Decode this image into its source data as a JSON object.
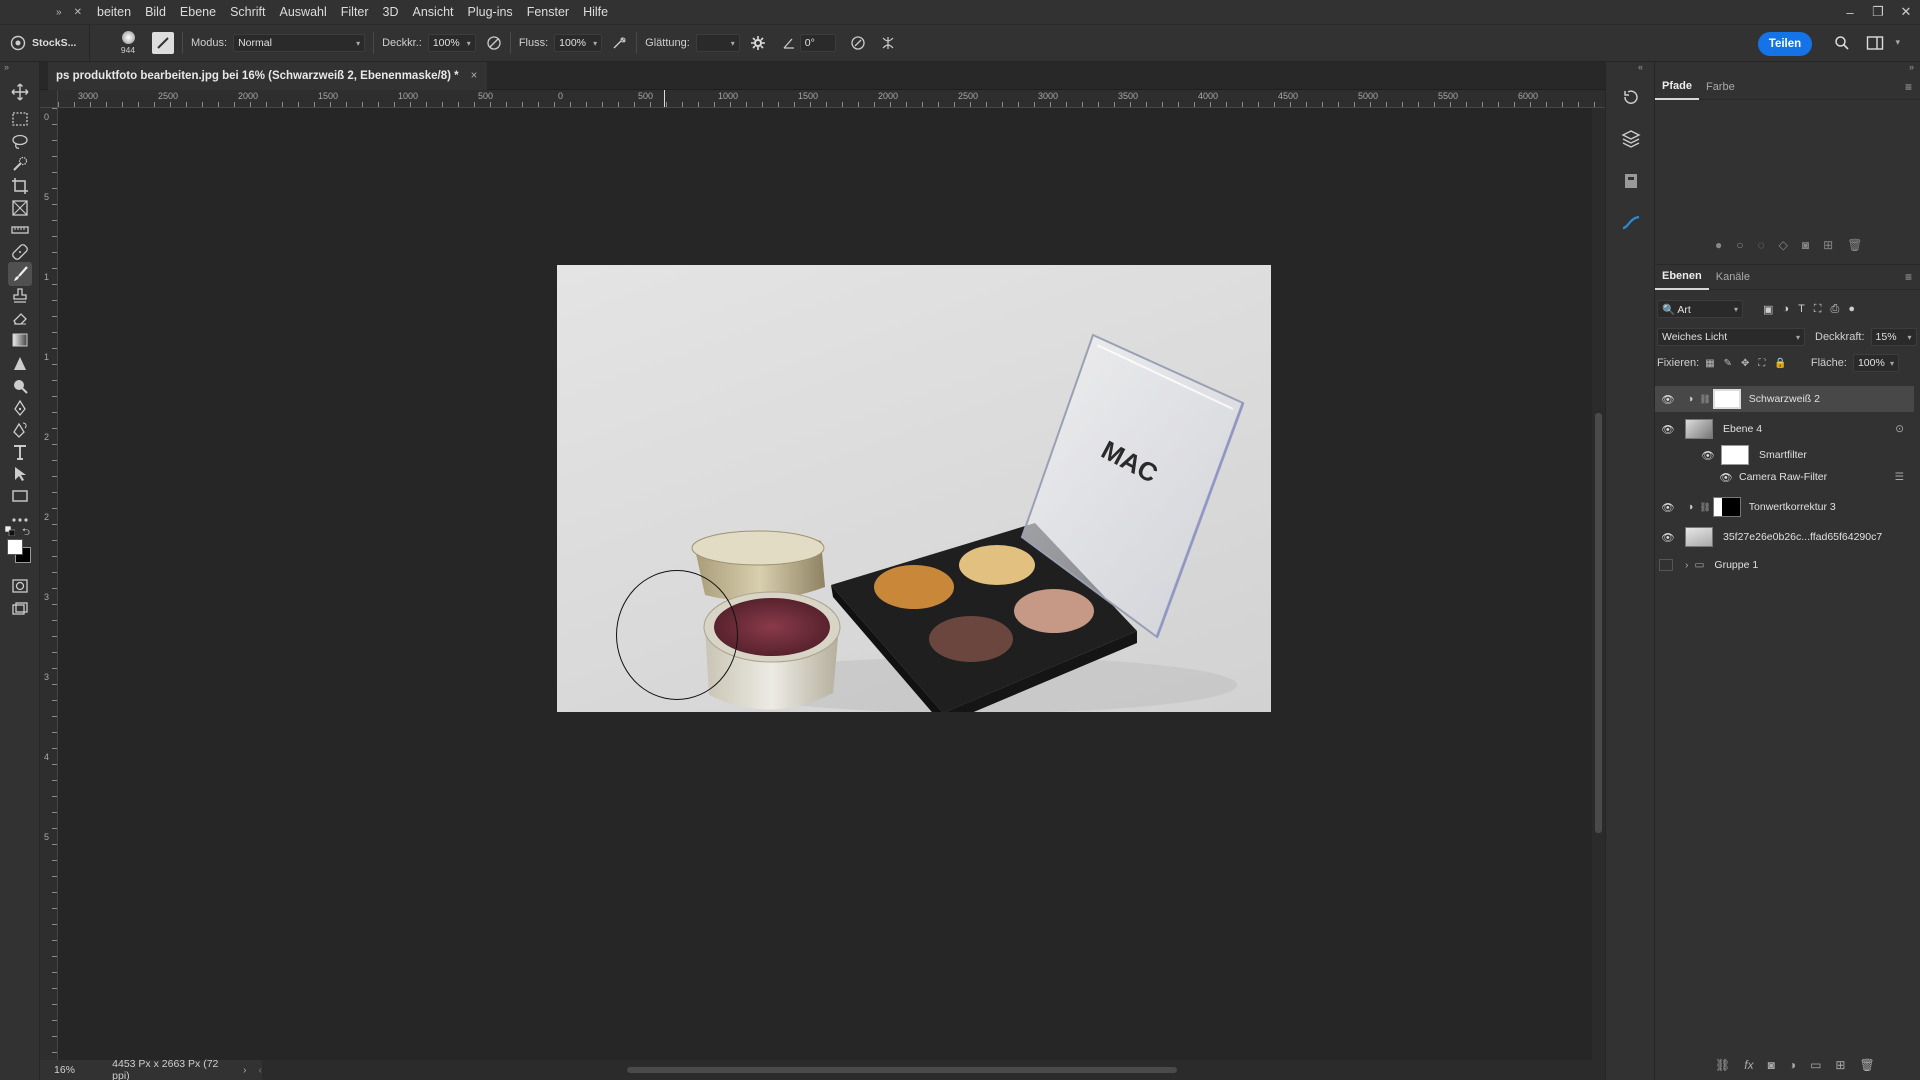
{
  "app": {
    "home_label": "StockS...",
    "menu": [
      "beiten",
      "Bild",
      "Ebene",
      "Schrift",
      "Auswahl",
      "Filter",
      "3D",
      "Ansicht",
      "Plug-ins",
      "Fenster",
      "Hilfe"
    ]
  },
  "options_bar": {
    "brush_size": "944",
    "mode_label": "Modus:",
    "mode_value": "Normal",
    "opacity_label": "Deckkr.:",
    "opacity_value": "100%",
    "flow_label": "Fluss:",
    "flow_value": "100%",
    "smoothing_label": "Glättung:",
    "smoothing_value": "",
    "angle_value": "0°",
    "share_label": "Teilen"
  },
  "document": {
    "tab_title": "ps produktfoto bearbeiten.jpg bei 16% (Schwarzweiß 2, Ebenenmaske/8) *",
    "zoom": "16%",
    "dimensions": "4453 Px x 2663 Px (72 ppi)",
    "ruler_top": [
      "3000",
      "2500",
      "2000",
      "1500",
      "1000",
      "500",
      "0",
      "500",
      "1000",
      "1500",
      "2000",
      "2500",
      "3000",
      "3500",
      "4000",
      "4500",
      "5000",
      "5500",
      "6000"
    ],
    "ruler_left": [
      "0",
      "5",
      "1",
      "1",
      "2",
      "2",
      "3",
      "3",
      "4",
      "5"
    ],
    "photo_logo_text": "MAC"
  },
  "panels": {
    "top_tabs": [
      "Pfade",
      "Farbe"
    ],
    "layers_tabs": [
      "Ebenen",
      "Kanäle"
    ],
    "filter_kind": "Art",
    "blend_mode": "Weiches Licht",
    "opacity_label": "Deckkraft:",
    "opacity_value": "15%",
    "lock_label": "Fixieren:",
    "fill_label": "Fläche:",
    "fill_value": "100%",
    "layers": [
      {
        "name": "Schwarzweiß 2"
      },
      {
        "name": "Ebene 4"
      },
      {
        "name": "Smartfilter"
      },
      {
        "name": "Camera Raw-Filter"
      },
      {
        "name": "Tonwertkorrektur 3"
      },
      {
        "name": "35f27e26e0b26c...ffad65f64290c7"
      },
      {
        "name": "Gruppe 1"
      }
    ]
  },
  "colors": {
    "accent": "#1473e6",
    "ui_dark": "#323232",
    "canvas": "#262626"
  }
}
